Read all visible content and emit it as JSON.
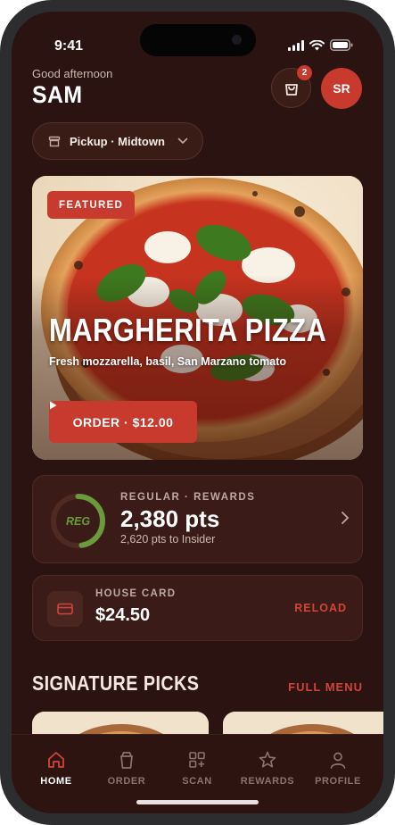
{
  "status": {
    "time": "9:41"
  },
  "header": {
    "greeting": "Good afternoon",
    "name": "SAM",
    "cart_count": "2",
    "avatar_initials": "SR"
  },
  "location": {
    "label": "Pickup · Midtown"
  },
  "featured": {
    "badge": "FEATURED",
    "title": "MARGHERITA PIZZA",
    "description": "Fresh mozzarella, basil, San Marzano tomato",
    "order_label": "ORDER · $12.00"
  },
  "rewards": {
    "ring_label": "REG",
    "tier": "REGULAR · REWARDS",
    "points": "2,380 pts",
    "to_next": "2,620 pts to Insider",
    "progress": 0.476
  },
  "house_card": {
    "label": "HOUSE CARD",
    "balance": "$24.50",
    "action": "RELOAD"
  },
  "picks": {
    "title": "SIGNATURE PICKS",
    "action": "FULL MENU"
  },
  "tabs": [
    {
      "label": "HOME",
      "icon": "home-icon",
      "active": true
    },
    {
      "label": "ORDER",
      "icon": "cup-icon",
      "active": false
    },
    {
      "label": "SCAN",
      "icon": "scan-icon",
      "active": false
    },
    {
      "label": "REWARDS",
      "icon": "star-icon",
      "active": false
    },
    {
      "label": "PROFILE",
      "icon": "person-icon",
      "active": false
    }
  ],
  "colors": {
    "accent": "#c93a2e",
    "background": "#2a1310",
    "card": "#3a1b17",
    "ring": "#6a9a3c"
  }
}
